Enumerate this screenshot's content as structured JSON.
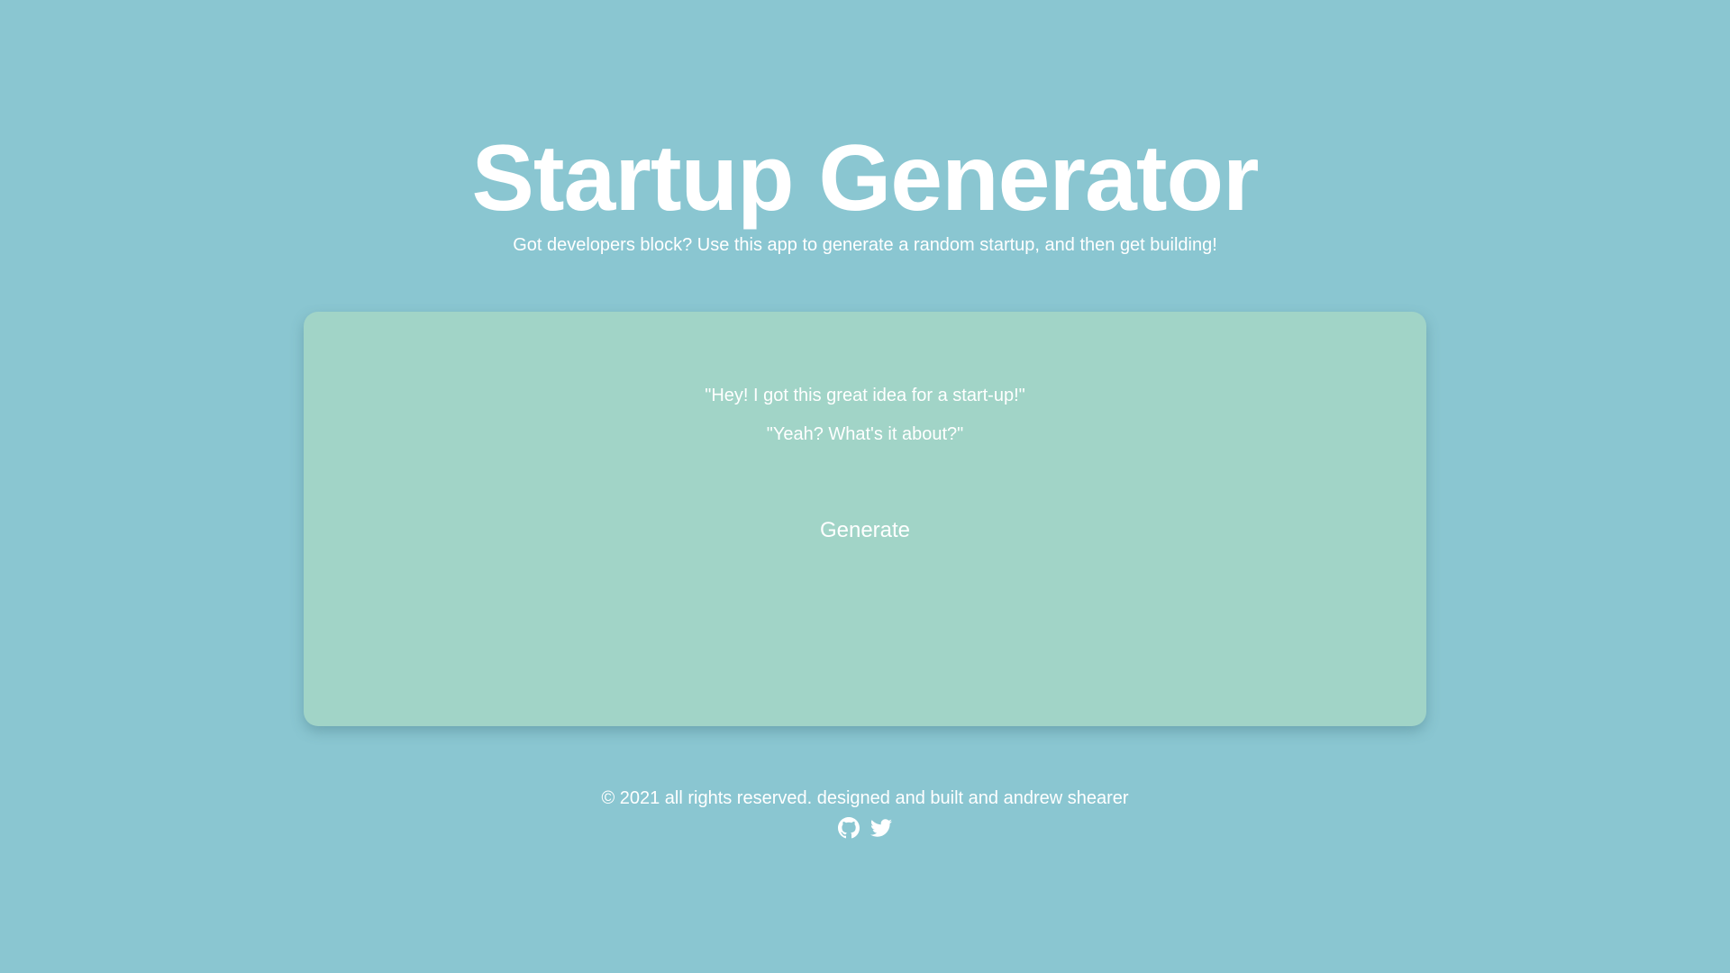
{
  "header": {
    "title": "Startup Generator",
    "subtitle": "Got developers block? Use this app to generate a random startup, and then get building!"
  },
  "card": {
    "quote_1": "\"Hey! I got this great idea for a start-up!\"",
    "quote_2": "\"Yeah? What's it about?\"",
    "generate_label": "Generate"
  },
  "footer": {
    "copyright": "© 2021 all rights reserved. designed and built and andrew shearer",
    "links": [
      {
        "icon": "github-icon"
      },
      {
        "icon": "twitter-icon"
      }
    ]
  },
  "colors": {
    "background": "#8ac6d1",
    "card": "#a1d4c7",
    "text": "#ffffff"
  }
}
